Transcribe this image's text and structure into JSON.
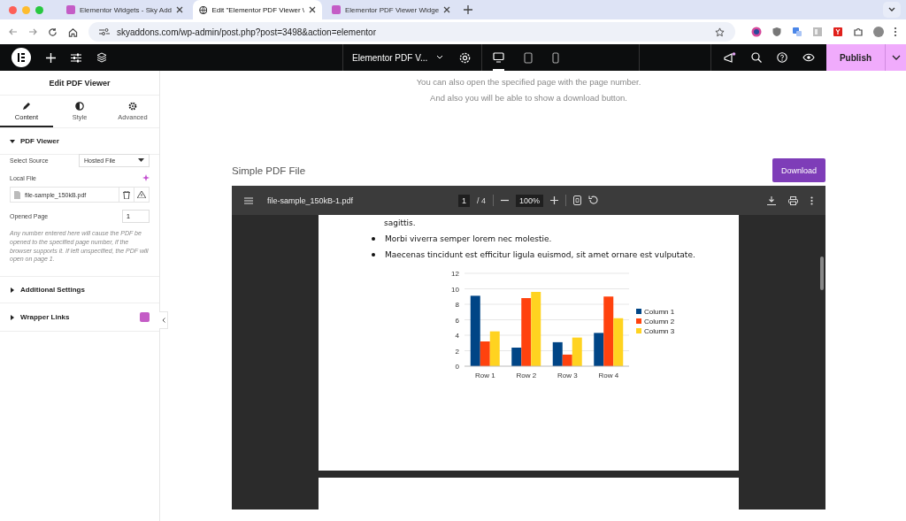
{
  "browser_tabs": [
    {
      "title": "Elementor Widgets - Sky Add",
      "selected": false
    },
    {
      "title": "Edit \"Elementor PDF Viewer \\",
      "selected": true
    },
    {
      "title": "Elementor PDF Viewer Widge",
      "selected": false
    }
  ],
  "address_bar": {
    "url": "skyaddons.com/wp-admin/post.php?post=3498&action=elementor"
  },
  "editor_bar": {
    "document_title": "Elementor PDF V...",
    "publish_label": "Publish"
  },
  "panel": {
    "title": "Edit PDF Viewer",
    "tabs": [
      {
        "label": "Content",
        "selected": true
      },
      {
        "label": "Style",
        "selected": false
      },
      {
        "label": "Advanced",
        "selected": false
      }
    ],
    "sections": [
      {
        "title": "PDF Viewer",
        "expanded": true
      },
      {
        "title": "Additional Settings",
        "expanded": false
      },
      {
        "title": "Wrapper Links",
        "expanded": false
      }
    ],
    "select_source": {
      "label": "Select Source",
      "value": "Hosted File"
    },
    "local_file": {
      "label": "Local File",
      "file_name": "file-sample_150kB.pdf"
    },
    "opened_page": {
      "label": "Opened Page",
      "value": "1",
      "help": "Any number entered here will cause the PDF be opened to the specified page number, if the browser supports it. If left unspecified, the PDF will open on page 1."
    }
  },
  "canvas": {
    "intro_lines": [
      "You can also open the specified page with the page number.",
      "And also you will be able to show a download button."
    ],
    "heading": "Simple PDF File",
    "download_label": "Download",
    "viewer": {
      "file_name": "file-sample_150kB-1.pdf",
      "page": "1",
      "page_total": "/ 4",
      "zoom": "100%",
      "continued_line": "sagittis.",
      "bullets": [
        "Morbi viverra semper lorem nec molestie.",
        "Maecenas tincidunt est efficitur ligula euismod, sit amet ornare est vulputate."
      ],
      "chart_data": {
        "type": "bar",
        "grid": true,
        "legend": true,
        "categories": [
          "Row 1",
          "Row 2",
          "Row 3",
          "Row 4"
        ],
        "ylim": [
          0,
          12
        ],
        "yticks": [
          0,
          2,
          4,
          6,
          8,
          10,
          12
        ],
        "series": [
          {
            "name": "Column 1",
            "color": "#004586",
            "values": [
              9.1,
              2.4,
              3.1,
              4.3
            ]
          },
          {
            "name": "Column 2",
            "color": "#ff420e",
            "values": [
              3.2,
              8.8,
              1.5,
              9.0
            ]
          },
          {
            "name": "Column 3",
            "color": "#ffd320",
            "values": [
              4.5,
              9.6,
              3.7,
              6.2
            ]
          }
        ]
      }
    }
  }
}
